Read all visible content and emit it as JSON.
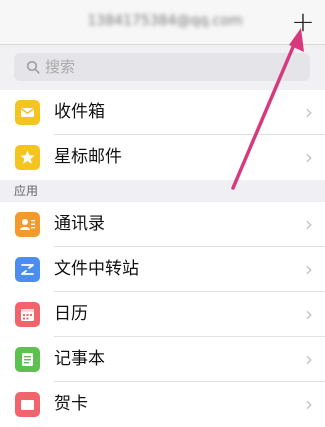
{
  "header": {
    "account": "1384175384@qq.com",
    "add_label": "+"
  },
  "search": {
    "placeholder": "搜索"
  },
  "mail_items": [
    {
      "label": "收件箱",
      "icon": "inbox-icon",
      "color": "#f4c521"
    },
    {
      "label": "星标邮件",
      "icon": "star-icon",
      "color": "#f4c521"
    }
  ],
  "section_title": "应用",
  "app_items": [
    {
      "label": "通讯录",
      "icon": "contacts-icon",
      "color": "#f39a2e"
    },
    {
      "label": "文件中转站",
      "icon": "file-transfer-icon",
      "color": "#4b8ef0"
    },
    {
      "label": "日历",
      "icon": "calendar-icon",
      "color": "#f0656b"
    },
    {
      "label": "记事本",
      "icon": "notepad-icon",
      "color": "#5cc24d"
    },
    {
      "label": "贺卡",
      "icon": "card-icon",
      "color": "#f0656b"
    }
  ],
  "colors": {
    "annotation_arrow": "#d63a7c"
  }
}
